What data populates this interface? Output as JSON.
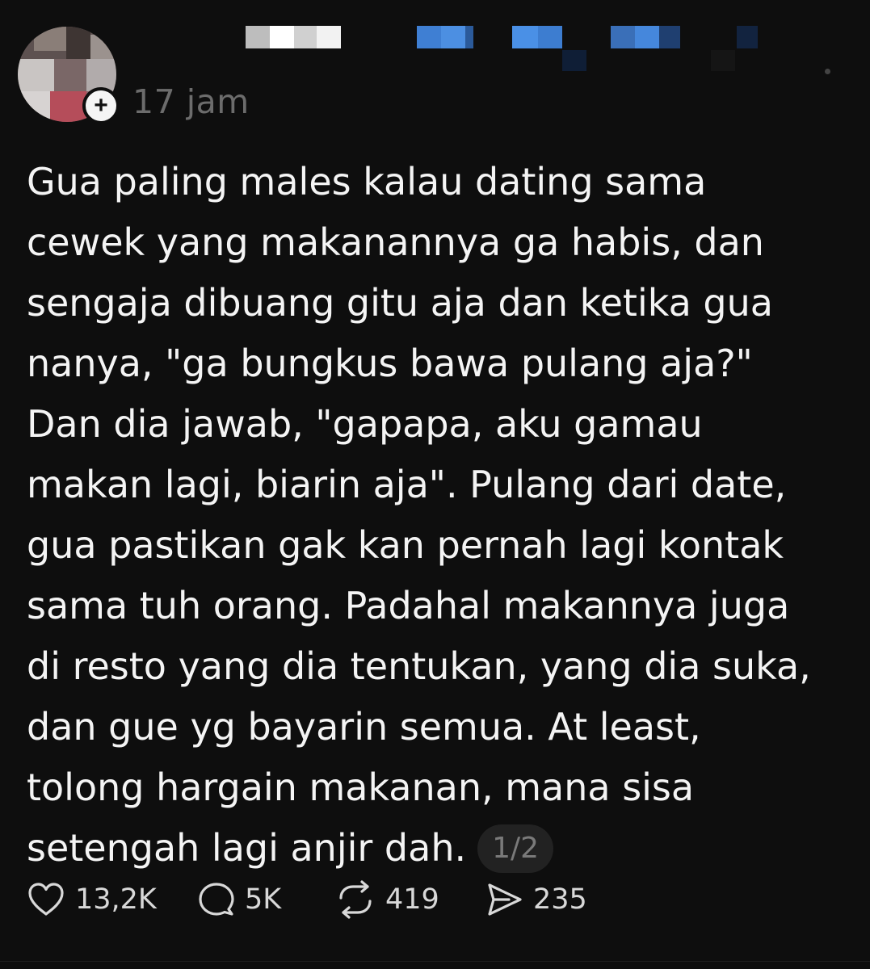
{
  "post": {
    "timestamp": "17 jam",
    "follow_symbol": "+",
    "body_lines": [
      "Gua paling males kalau dating sama",
      "cewek yang makanannya ga habis, dan",
      "sengaja dibuang gitu aja dan ketika gua",
      "nanya, \"ga bungkus bawa pulang aja?\"",
      "Dan dia jawab, \"gapapa, aku gamau",
      "makan lagi, biarin aja\". Pulang dari date,",
      "gua pastikan gak kan pernah lagi kontak",
      "sama tuh orang. Padahal makannya juga",
      "di resto yang dia tentukan, yang dia suka,",
      "dan gue yg bayarin semua. At least,",
      "tolong hargain makanan, mana sisa",
      "setengah lagi anjir dah."
    ],
    "page_indicator": "1/2"
  },
  "actions": {
    "likes": "13,2K",
    "replies": "5K",
    "reposts": "419",
    "shares": "235"
  },
  "icons": {
    "like": "heart-icon",
    "reply": "speech-bubble-icon",
    "repost": "repost-icon",
    "share": "send-icon",
    "more": "more-dots-icon"
  },
  "colors": {
    "background": "#0e0e0e",
    "text": "#f4f4f4",
    "muted": "#6c6c6c",
    "pill": "#222222"
  }
}
